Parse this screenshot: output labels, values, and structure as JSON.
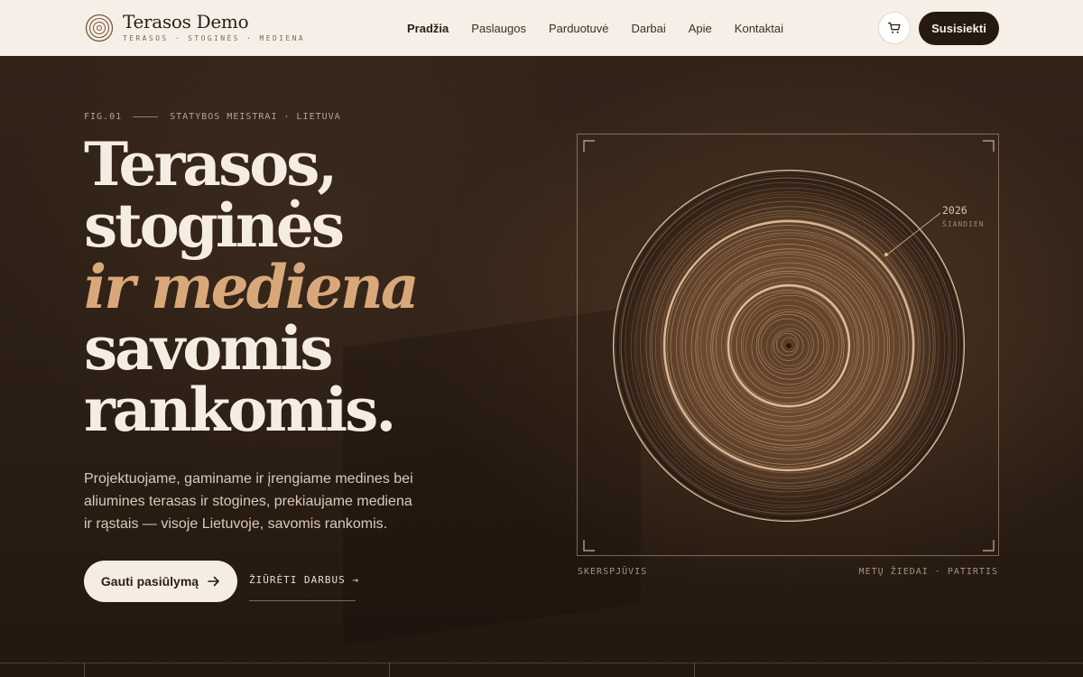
{
  "brand": {
    "name": "Terasos Demo",
    "tagline": "TERASOS · STOGINĖS · MEDIENA"
  },
  "nav": {
    "items": [
      {
        "label": "Pradžia",
        "active": true
      },
      {
        "label": "Paslaugos",
        "active": false
      },
      {
        "label": "Parduotuvė",
        "active": false
      },
      {
        "label": "Darbai",
        "active": false
      },
      {
        "label": "Apie",
        "active": false
      },
      {
        "label": "Kontaktai",
        "active": false
      }
    ],
    "cart_icon": "cart-icon",
    "contact_label": "Susisiekti"
  },
  "hero": {
    "eyebrow_fig": "FIG.01",
    "eyebrow_text": "STATYBOS MEISTRAI · LIETUVA",
    "headline": {
      "line1": "Terasos,",
      "line2": "stoginės",
      "line3": "ir mediena",
      "line4": "savomis",
      "line5": "rankomis."
    },
    "lead": "Projektuojame, gaminame ir įrengiame medines bei aliumines terasas ir stogines, prekiaujame mediena ir rąstais — visoje Lietuvoje, savomis rankomis.",
    "cta_primary": "Gauti pasiūlymą",
    "cta_primary_icon": "arrow-right-icon",
    "cta_secondary": "ŽIŪRĖTI DARBUS →"
  },
  "figure": {
    "year": "2026",
    "year_label": "ŠIANDIEN",
    "caption_left": "SKERSPJŪVIS",
    "caption_right": "METŲ ŽIEDAI · PATIRTIS",
    "ring_color": "#e8c9a2",
    "accent": "#d9a87a"
  },
  "colors": {
    "nav_bg": "#f5efe7",
    "hero_bg": "#2b1e15",
    "button_dark": "#261910",
    "accent": "#d9a87a"
  }
}
